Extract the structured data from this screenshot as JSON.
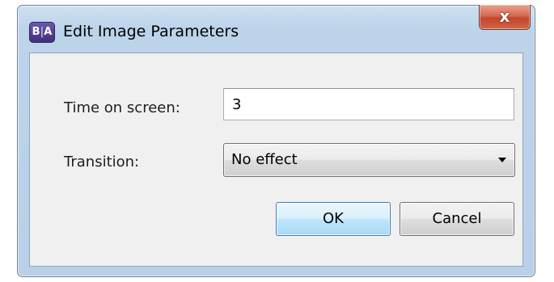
{
  "window": {
    "title": "Edit Image Parameters",
    "app_icon_text": "B|A",
    "icon": "app-logo-icon",
    "close_icon": "close-icon",
    "close_glyph": "x"
  },
  "form": {
    "time_on_screen_label": "Time on screen:",
    "time_on_screen_value": "3",
    "transition_label": "Transition:",
    "transition_value": "No effect",
    "transition_arrow_icon": "dropdown-arrow-icon"
  },
  "buttons": {
    "ok_label": "OK",
    "cancel_label": "Cancel"
  },
  "colors": {
    "titlebar": "#bcd3ea",
    "close_button": "#c4452a",
    "ok_button_accent": "#a7d9f5",
    "client_background": "#f0f0f0"
  }
}
